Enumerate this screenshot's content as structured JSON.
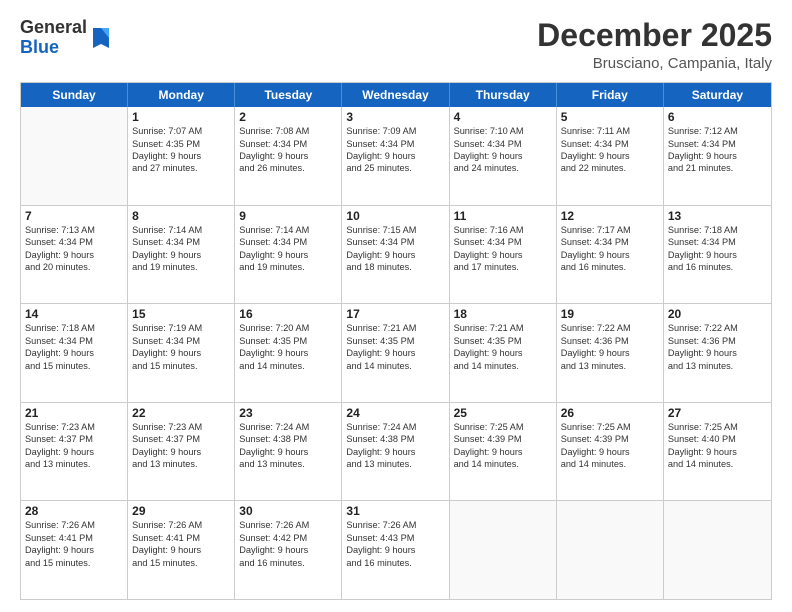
{
  "header": {
    "logo_general": "General",
    "logo_blue": "Blue",
    "month_title": "December 2025",
    "location": "Brusciano, Campania, Italy"
  },
  "calendar": {
    "days_of_week": [
      "Sunday",
      "Monday",
      "Tuesday",
      "Wednesday",
      "Thursday",
      "Friday",
      "Saturday"
    ],
    "rows": [
      [
        {
          "day": "",
          "info": ""
        },
        {
          "day": "1",
          "info": "Sunrise: 7:07 AM\nSunset: 4:35 PM\nDaylight: 9 hours\nand 27 minutes."
        },
        {
          "day": "2",
          "info": "Sunrise: 7:08 AM\nSunset: 4:34 PM\nDaylight: 9 hours\nand 26 minutes."
        },
        {
          "day": "3",
          "info": "Sunrise: 7:09 AM\nSunset: 4:34 PM\nDaylight: 9 hours\nand 25 minutes."
        },
        {
          "day": "4",
          "info": "Sunrise: 7:10 AM\nSunset: 4:34 PM\nDaylight: 9 hours\nand 24 minutes."
        },
        {
          "day": "5",
          "info": "Sunrise: 7:11 AM\nSunset: 4:34 PM\nDaylight: 9 hours\nand 22 minutes."
        },
        {
          "day": "6",
          "info": "Sunrise: 7:12 AM\nSunset: 4:34 PM\nDaylight: 9 hours\nand 21 minutes."
        }
      ],
      [
        {
          "day": "7",
          "info": "Sunrise: 7:13 AM\nSunset: 4:34 PM\nDaylight: 9 hours\nand 20 minutes."
        },
        {
          "day": "8",
          "info": "Sunrise: 7:14 AM\nSunset: 4:34 PM\nDaylight: 9 hours\nand 19 minutes."
        },
        {
          "day": "9",
          "info": "Sunrise: 7:14 AM\nSunset: 4:34 PM\nDaylight: 9 hours\nand 19 minutes."
        },
        {
          "day": "10",
          "info": "Sunrise: 7:15 AM\nSunset: 4:34 PM\nDaylight: 9 hours\nand 18 minutes."
        },
        {
          "day": "11",
          "info": "Sunrise: 7:16 AM\nSunset: 4:34 PM\nDaylight: 9 hours\nand 17 minutes."
        },
        {
          "day": "12",
          "info": "Sunrise: 7:17 AM\nSunset: 4:34 PM\nDaylight: 9 hours\nand 16 minutes."
        },
        {
          "day": "13",
          "info": "Sunrise: 7:18 AM\nSunset: 4:34 PM\nDaylight: 9 hours\nand 16 minutes."
        }
      ],
      [
        {
          "day": "14",
          "info": "Sunrise: 7:18 AM\nSunset: 4:34 PM\nDaylight: 9 hours\nand 15 minutes."
        },
        {
          "day": "15",
          "info": "Sunrise: 7:19 AM\nSunset: 4:34 PM\nDaylight: 9 hours\nand 15 minutes."
        },
        {
          "day": "16",
          "info": "Sunrise: 7:20 AM\nSunset: 4:35 PM\nDaylight: 9 hours\nand 14 minutes."
        },
        {
          "day": "17",
          "info": "Sunrise: 7:21 AM\nSunset: 4:35 PM\nDaylight: 9 hours\nand 14 minutes."
        },
        {
          "day": "18",
          "info": "Sunrise: 7:21 AM\nSunset: 4:35 PM\nDaylight: 9 hours\nand 14 minutes."
        },
        {
          "day": "19",
          "info": "Sunrise: 7:22 AM\nSunset: 4:36 PM\nDaylight: 9 hours\nand 13 minutes."
        },
        {
          "day": "20",
          "info": "Sunrise: 7:22 AM\nSunset: 4:36 PM\nDaylight: 9 hours\nand 13 minutes."
        }
      ],
      [
        {
          "day": "21",
          "info": "Sunrise: 7:23 AM\nSunset: 4:37 PM\nDaylight: 9 hours\nand 13 minutes."
        },
        {
          "day": "22",
          "info": "Sunrise: 7:23 AM\nSunset: 4:37 PM\nDaylight: 9 hours\nand 13 minutes."
        },
        {
          "day": "23",
          "info": "Sunrise: 7:24 AM\nSunset: 4:38 PM\nDaylight: 9 hours\nand 13 minutes."
        },
        {
          "day": "24",
          "info": "Sunrise: 7:24 AM\nSunset: 4:38 PM\nDaylight: 9 hours\nand 13 minutes."
        },
        {
          "day": "25",
          "info": "Sunrise: 7:25 AM\nSunset: 4:39 PM\nDaylight: 9 hours\nand 14 minutes."
        },
        {
          "day": "26",
          "info": "Sunrise: 7:25 AM\nSunset: 4:39 PM\nDaylight: 9 hours\nand 14 minutes."
        },
        {
          "day": "27",
          "info": "Sunrise: 7:25 AM\nSunset: 4:40 PM\nDaylight: 9 hours\nand 14 minutes."
        }
      ],
      [
        {
          "day": "28",
          "info": "Sunrise: 7:26 AM\nSunset: 4:41 PM\nDaylight: 9 hours\nand 15 minutes."
        },
        {
          "day": "29",
          "info": "Sunrise: 7:26 AM\nSunset: 4:41 PM\nDaylight: 9 hours\nand 15 minutes."
        },
        {
          "day": "30",
          "info": "Sunrise: 7:26 AM\nSunset: 4:42 PM\nDaylight: 9 hours\nand 16 minutes."
        },
        {
          "day": "31",
          "info": "Sunrise: 7:26 AM\nSunset: 4:43 PM\nDaylight: 9 hours\nand 16 minutes."
        },
        {
          "day": "",
          "info": ""
        },
        {
          "day": "",
          "info": ""
        },
        {
          "day": "",
          "info": ""
        }
      ]
    ]
  }
}
